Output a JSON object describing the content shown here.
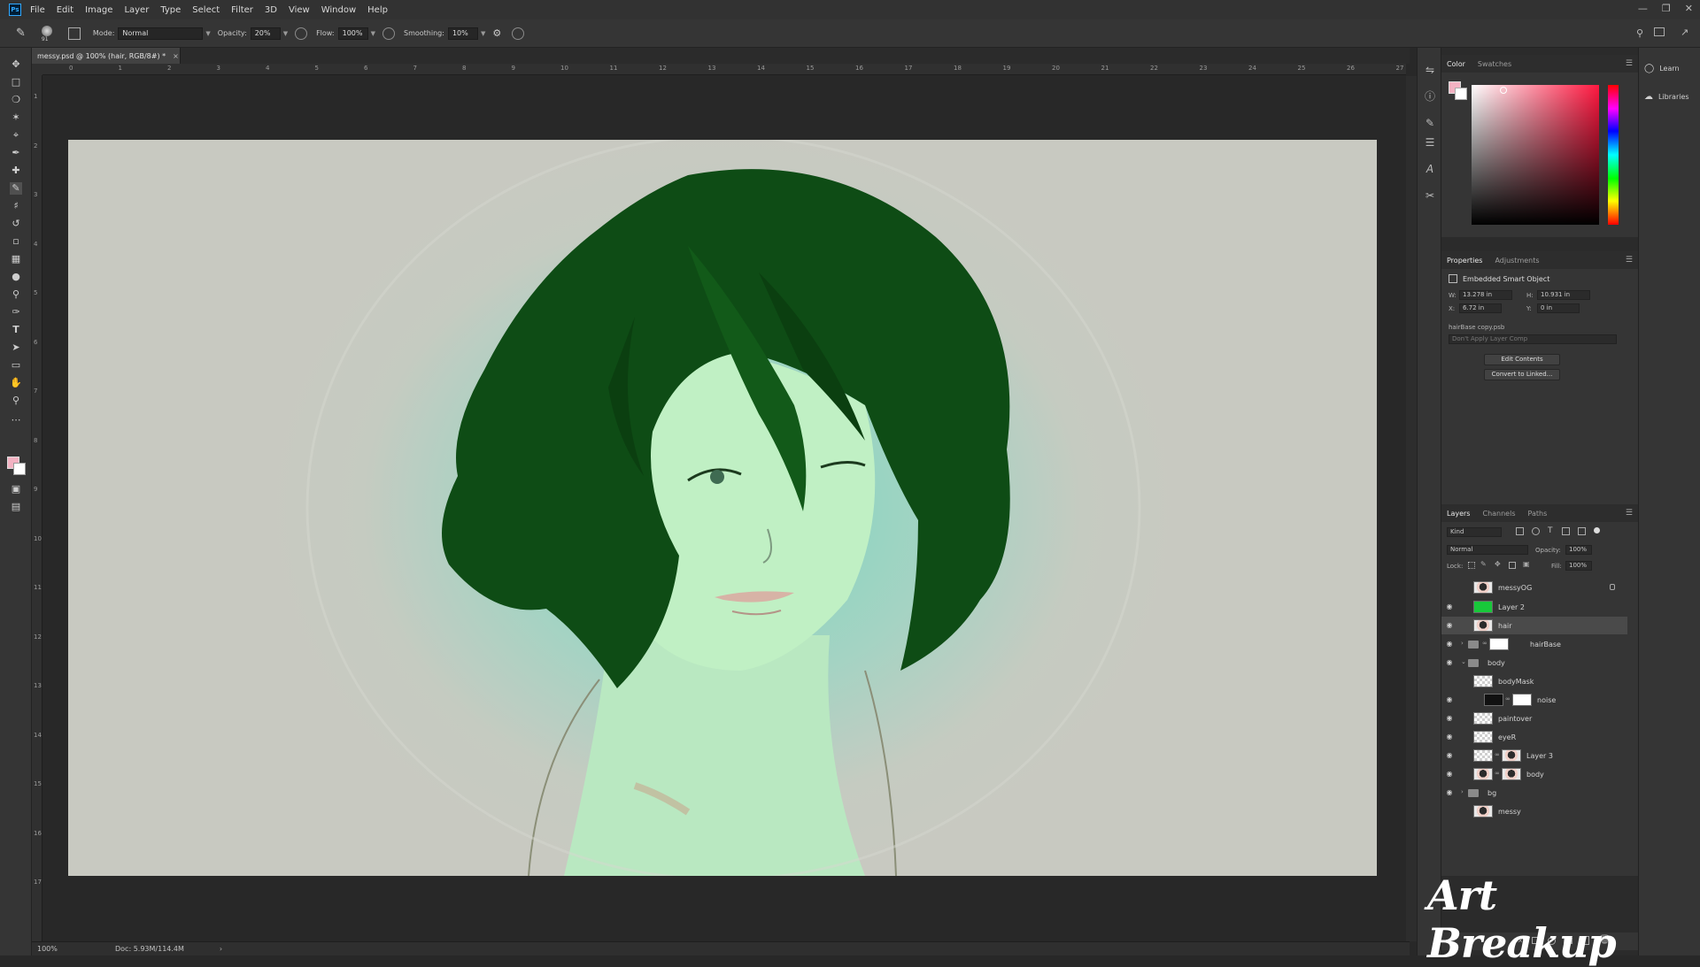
{
  "app": {
    "logo": "Ps",
    "menus": [
      "File",
      "Edit",
      "Image",
      "Layer",
      "Type",
      "Select",
      "Filter",
      "3D",
      "View",
      "Window",
      "Help"
    ]
  },
  "options": {
    "brush_size": "91",
    "mode_label": "Mode:",
    "mode_value": "Normal",
    "opacity_label": "Opacity:",
    "opacity_value": "20%",
    "flow_label": "Flow:",
    "flow_value": "100%",
    "smoothing_label": "Smoothing:",
    "smoothing_value": "10%"
  },
  "document": {
    "tab_title": "messy.psd @ 100% (hair, RGB/8#) *",
    "tab_close": "×",
    "zoom": "100%",
    "doc_size": "Doc: 5.93M/114.4M",
    "ruler_h": [
      "0",
      "1",
      "2",
      "3",
      "4",
      "5",
      "6",
      "7",
      "8",
      "9",
      "10",
      "11",
      "12",
      "13",
      "14",
      "15",
      "16",
      "17",
      "18",
      "19",
      "20",
      "21",
      "22",
      "23",
      "24",
      "25",
      "26",
      "27"
    ],
    "ruler_v": [
      "1",
      "2",
      "3",
      "4",
      "5",
      "6",
      "7",
      "8",
      "9",
      "10",
      "11",
      "12",
      "13",
      "14",
      "15",
      "16",
      "17"
    ]
  },
  "color_panel": {
    "tabs": [
      "Color",
      "Swatches"
    ],
    "foreground": "#f2b2c2",
    "background": "#ffffff"
  },
  "properties": {
    "tabs": [
      "Properties",
      "Adjustments"
    ],
    "type": "Embedded Smart Object",
    "w_label": "W:",
    "w_value": "13.278 in",
    "h_label": "H:",
    "h_value": "10.931 in",
    "x_label": "X:",
    "x_value": "6.72 in",
    "y_label": "Y:",
    "y_value": "0 in",
    "source": "hairBase copy.psb",
    "layer_comp": "Don't Apply Layer Comp",
    "btn_edit": "Edit Contents",
    "btn_convert": "Convert to Linked..."
  },
  "layers_panel": {
    "tabs": [
      "Layers",
      "Channels",
      "Paths"
    ],
    "filter_kind": "Kind",
    "blend_mode": "Normal",
    "opacity_label": "Opacity:",
    "opacity_value": "100%",
    "lock_label": "Lock:",
    "fill_label": "Fill:",
    "fill_value": "100%",
    "layers": [
      {
        "name": "messyOG",
        "visible": false,
        "thumb": "art",
        "locked": true
      },
      {
        "name": "Layer 2",
        "visible": true,
        "thumb": "green"
      },
      {
        "name": "hair",
        "visible": true,
        "thumb": "art",
        "selected": true
      },
      {
        "name": "hairBase",
        "visible": true,
        "thumb": "folder-mask"
      },
      {
        "name": "body",
        "visible": true,
        "thumb": "folder"
      },
      {
        "name": "bodyMask",
        "visible": false,
        "thumb": "checker"
      },
      {
        "name": "noise",
        "visible": true,
        "thumb": "black-mask"
      },
      {
        "name": "paintover",
        "visible": true,
        "thumb": "checker"
      },
      {
        "name": "eyeR",
        "visible": true,
        "thumb": "checker"
      },
      {
        "name": "Layer 3",
        "visible": true,
        "thumb": "checker-mask"
      },
      {
        "name": "body",
        "visible": true,
        "thumb": "art-mask"
      },
      {
        "name": "bg",
        "visible": true,
        "thumb": "folder"
      },
      {
        "name": "messy",
        "visible": false,
        "thumb": "art"
      }
    ]
  },
  "side_panel": {
    "learn": "Learn",
    "libraries": "Libraries"
  },
  "watermark": "Art Breakup"
}
